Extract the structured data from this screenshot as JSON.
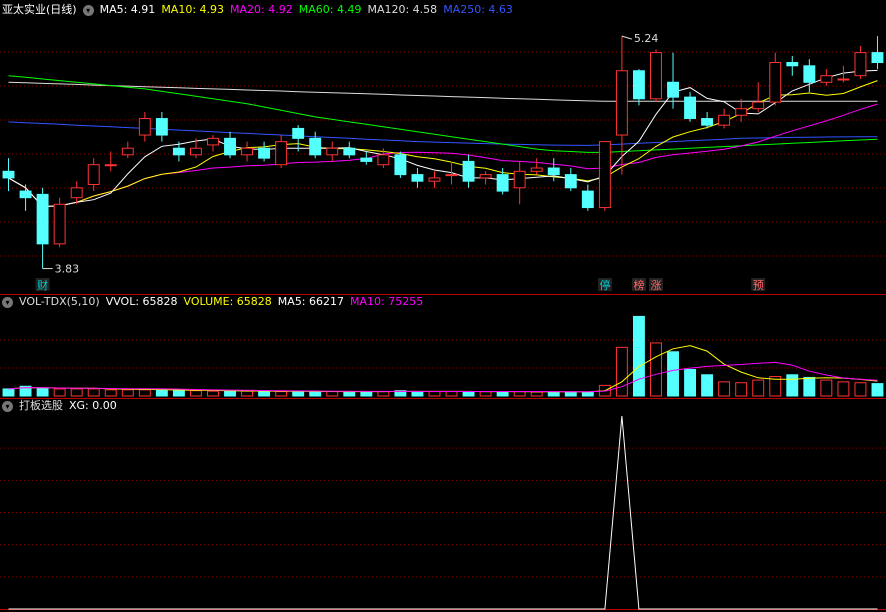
{
  "price_header": {
    "title": "亚太实业(日线)",
    "items": [
      {
        "label": "MA5:",
        "value": "4.91",
        "color": "#ffffff"
      },
      {
        "label": "MA10:",
        "value": "4.93",
        "color": "#ffff00"
      },
      {
        "label": "MA20:",
        "value": "4.92",
        "color": "#ff00ff"
      },
      {
        "label": "MA60:",
        "value": "4.49",
        "color": "#00ff00"
      },
      {
        "label": "MA120:",
        "value": "4.58",
        "color": "#dddddd"
      },
      {
        "label": "MA250:",
        "value": "4.63",
        "color": "#3355ff"
      }
    ]
  },
  "vol_header": {
    "title": "VOL-TDX(5,10)",
    "items": [
      {
        "label": "VVOL:",
        "value": "65828",
        "color": "#ffffff"
      },
      {
        "label": "VOLUME:",
        "value": "65828",
        "color": "#ffff00"
      },
      {
        "label": "MA5:",
        "value": "66217",
        "color": "#ffffff"
      },
      {
        "label": "MA10:",
        "value": "75255",
        "color": "#ff00ff"
      }
    ]
  },
  "xg_header": {
    "title": "打板选股",
    "items": [
      {
        "label": "XG:",
        "value": "0.00",
        "color": "#ffffff"
      }
    ]
  },
  "price_panel": {
    "high_label": "5.24",
    "low_label": "3.83",
    "markers": [
      {
        "text": "财",
        "index": 2,
        "color": "#00cccc"
      },
      {
        "text": "停",
        "index": 35,
        "color": "#00cccc"
      },
      {
        "text": "榜",
        "index": 37,
        "color": "#ff6666"
      },
      {
        "text": "涨",
        "index": 38,
        "color": "#ff6666"
      },
      {
        "text": "预",
        "index": 44,
        "color": "#ff6666"
      }
    ]
  },
  "colors": {
    "up": "#ff3333",
    "down": "#54ffff",
    "grid": "#880000",
    "ma5": "#ffffff",
    "ma10": "#ffff00",
    "ma20": "#ff00ff",
    "ma60": "#00ff00",
    "ma120": "#dddddd",
    "ma250": "#3355ff"
  },
  "chart_data": {
    "type": "candlestick",
    "bars": 52,
    "price_ylim": [
      3.7,
      5.35
    ],
    "candles": [
      [
        4.42,
        4.38,
        4.5,
        4.3
      ],
      [
        4.3,
        4.26,
        4.34,
        4.18
      ],
      [
        4.28,
        3.98,
        4.32,
        3.83
      ],
      [
        3.98,
        4.22,
        4.26,
        3.96
      ],
      [
        4.26,
        4.32,
        4.36,
        4.22
      ],
      [
        4.34,
        4.46,
        4.5,
        4.3
      ],
      [
        4.46,
        4.46,
        4.54,
        4.42
      ],
      [
        4.52,
        4.56,
        4.6,
        4.5
      ],
      [
        4.64,
        4.74,
        4.78,
        4.6
      ],
      [
        4.74,
        4.64,
        4.78,
        4.6
      ],
      [
        4.56,
        4.52,
        4.6,
        4.48
      ],
      [
        4.52,
        4.56,
        4.62,
        4.5
      ],
      [
        4.58,
        4.62,
        4.64,
        4.54
      ],
      [
        4.62,
        4.52,
        4.66,
        4.5
      ],
      [
        4.52,
        4.56,
        4.6,
        4.48
      ],
      [
        4.56,
        4.5,
        4.6,
        4.48
      ],
      [
        4.46,
        4.6,
        4.64,
        4.44
      ],
      [
        4.68,
        4.62,
        4.7,
        4.54
      ],
      [
        4.62,
        4.52,
        4.66,
        4.5
      ],
      [
        4.52,
        4.56,
        4.6,
        4.48
      ],
      [
        4.56,
        4.52,
        4.6,
        4.5
      ],
      [
        4.5,
        4.48,
        4.54,
        4.46
      ],
      [
        4.46,
        4.52,
        4.56,
        4.44
      ],
      [
        4.52,
        4.4,
        4.54,
        4.38
      ],
      [
        4.4,
        4.36,
        4.44,
        4.32
      ],
      [
        4.36,
        4.38,
        4.42,
        4.32
      ],
      [
        4.4,
        4.4,
        4.48,
        4.34
      ],
      [
        4.48,
        4.36,
        4.52,
        4.32
      ],
      [
        4.38,
        4.4,
        4.42,
        4.34
      ],
      [
        4.4,
        4.3,
        4.44,
        4.28
      ],
      [
        4.32,
        4.42,
        4.48,
        4.22
      ],
      [
        4.42,
        4.44,
        4.5,
        4.4
      ],
      [
        4.44,
        4.4,
        4.5,
        4.36
      ],
      [
        4.4,
        4.32,
        4.44,
        4.3
      ],
      [
        4.3,
        4.2,
        4.34,
        4.18
      ],
      [
        4.2,
        4.6,
        4.6,
        4.18
      ],
      [
        4.64,
        5.03,
        5.24,
        4.4
      ],
      [
        5.03,
        4.86,
        5.04,
        4.82
      ],
      [
        4.86,
        5.14,
        5.16,
        4.84
      ],
      [
        4.96,
        4.87,
        5.14,
        4.8
      ],
      [
        4.87,
        4.74,
        4.9,
        4.72
      ],
      [
        4.74,
        4.7,
        4.78,
        4.68
      ],
      [
        4.7,
        4.76,
        4.8,
        4.68
      ],
      [
        4.76,
        4.8,
        4.86,
        4.72
      ],
      [
        4.8,
        4.84,
        4.96,
        4.78
      ],
      [
        4.84,
        5.08,
        5.14,
        4.82
      ],
      [
        5.08,
        5.06,
        5.12,
        5.0
      ],
      [
        5.06,
        4.96,
        5.1,
        4.9
      ],
      [
        4.96,
        5.0,
        5.04,
        4.94
      ],
      [
        4.98,
        4.98,
        5.06,
        4.96
      ],
      [
        5.0,
        5.14,
        5.18,
        4.98
      ],
      [
        5.14,
        5.08,
        5.24,
        5.04
      ]
    ],
    "volume_ylim": [
      0,
      95000
    ],
    "volume": [
      8000,
      11000,
      9000,
      8000,
      8000,
      8000,
      7000,
      7000,
      7000,
      7000,
      6000,
      6000,
      5500,
      5500,
      5500,
      5500,
      5000,
      5000,
      5000,
      5000,
      5000,
      5000,
      5000,
      6000,
      5000,
      5000,
      5000,
      5000,
      5000,
      5000,
      5000,
      4500,
      4500,
      4500,
      4500,
      12000,
      55000,
      90000,
      60000,
      50000,
      30000,
      24000,
      16000,
      15000,
      18000,
      22000,
      24000,
      21000,
      18000,
      16000,
      15000,
      14000
    ],
    "xg_values": [
      0,
      0,
      0,
      0,
      0,
      0,
      0,
      0,
      0,
      0,
      0,
      0,
      0,
      0,
      0,
      0,
      0,
      0,
      0,
      0,
      0,
      0,
      0,
      0,
      0,
      0,
      0,
      0,
      0,
      0,
      0,
      0,
      0,
      0,
      0,
      0,
      1,
      0,
      0,
      0,
      0,
      0,
      0,
      0,
      0,
      0,
      0,
      0,
      0,
      0,
      0,
      0
    ],
    "ma120": [
      4.96,
      4.957,
      4.953,
      4.95,
      4.947,
      4.943,
      4.94,
      4.937,
      4.933,
      4.93,
      4.927,
      4.923,
      4.92,
      4.917,
      4.913,
      4.91,
      4.907,
      4.903,
      4.9,
      4.897,
      4.893,
      4.89,
      4.887,
      4.883,
      4.88,
      4.877,
      4.873,
      4.87,
      4.867,
      4.863,
      4.86,
      4.857,
      4.853,
      4.85,
      4.847,
      4.845,
      4.845,
      4.845,
      4.845,
      4.845,
      4.845,
      4.845,
      4.845,
      4.845,
      4.845,
      4.845,
      4.845,
      4.845,
      4.845,
      4.845,
      4.845,
      4.845
    ],
    "ma250": [
      4.72,
      4.715,
      4.71,
      4.705,
      4.7,
      4.695,
      4.69,
      4.685,
      4.68,
      4.675,
      4.67,
      4.665,
      4.66,
      4.655,
      4.65,
      4.645,
      4.64,
      4.635,
      4.63,
      4.625,
      4.62,
      4.615,
      4.61,
      4.605,
      4.6,
      4.597,
      4.594,
      4.591,
      4.588,
      4.585,
      4.583,
      4.581,
      4.579,
      4.578,
      4.577,
      4.58,
      4.585,
      4.59,
      4.595,
      4.6,
      4.605,
      4.61,
      4.615,
      4.62,
      4.622,
      4.624,
      4.626,
      4.627,
      4.628,
      4.629,
      4.63,
      4.63
    ],
    "ma60": [
      5.0,
      4.99,
      4.98,
      4.97,
      4.96,
      4.95,
      4.94,
      4.93,
      4.92,
      4.905,
      4.89,
      4.875,
      4.86,
      4.845,
      4.83,
      4.81,
      4.79,
      4.77,
      4.75,
      4.735,
      4.72,
      4.705,
      4.69,
      4.675,
      4.66,
      4.645,
      4.63,
      4.615,
      4.6,
      4.585,
      4.57,
      4.555,
      4.545,
      4.54,
      4.535,
      4.535,
      4.54,
      4.545,
      4.55,
      4.555,
      4.56,
      4.565,
      4.57,
      4.575,
      4.58,
      4.585,
      4.59,
      4.595,
      4.6,
      4.605,
      4.61,
      4.615
    ]
  }
}
